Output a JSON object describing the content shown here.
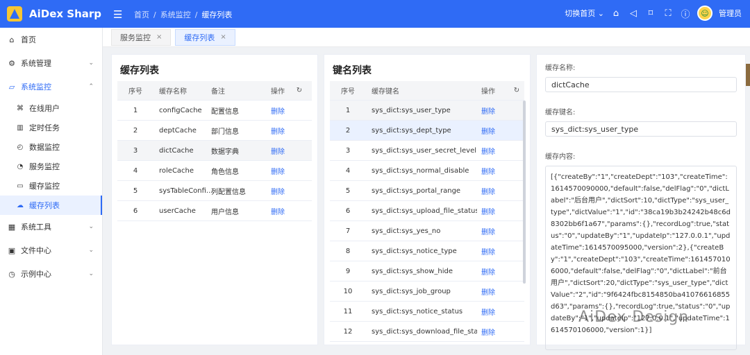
{
  "app": {
    "title": "AiDex Sharp",
    "menu_icon": "menu-fold-icon"
  },
  "breadcrumb": [
    "首页",
    "系统监控",
    "缓存列表"
  ],
  "topbar": {
    "switch_home": "切换首页",
    "user": "管理员"
  },
  "sidebar": {
    "items": [
      {
        "label": "首页",
        "icon": "home-icon"
      },
      {
        "label": "系统管理",
        "icon": "settings-icon"
      },
      {
        "label": "系统监控",
        "icon": "monitor-icon"
      },
      {
        "label": "系统工具",
        "icon": "grid-icon"
      },
      {
        "label": "文件中心",
        "icon": "file-icon"
      },
      {
        "label": "示例中心",
        "icon": "sample-icon"
      }
    ],
    "subitems": [
      {
        "label": "在线用户",
        "icon": "chart-icon"
      },
      {
        "label": "定时任务",
        "icon": "bar-icon"
      },
      {
        "label": "数据监控",
        "icon": "dashboard-icon"
      },
      {
        "label": "服务监控",
        "icon": "pie-icon"
      },
      {
        "label": "缓存监控",
        "icon": "cache-icon"
      },
      {
        "label": "缓存列表",
        "icon": "cloud-icon"
      }
    ]
  },
  "tabs": [
    {
      "label": "服务监控"
    },
    {
      "label": "缓存列表"
    }
  ],
  "cache_table": {
    "title": "缓存列表",
    "headers": [
      "序号",
      "缓存名称",
      "备注",
      "操作"
    ],
    "rows": [
      {
        "no": "1",
        "name": "configCache",
        "note": "配置信息",
        "action": "删除"
      },
      {
        "no": "2",
        "name": "deptCache",
        "note": "部门信息",
        "action": "删除"
      },
      {
        "no": "3",
        "name": "dictCache",
        "note": "数据字典",
        "action": "删除"
      },
      {
        "no": "4",
        "name": "roleCache",
        "note": "角色信息",
        "action": "删除"
      },
      {
        "no": "5",
        "name": "sysTableConfi...",
        "note": "列配置信息",
        "action": "删除"
      },
      {
        "no": "6",
        "name": "userCache",
        "note": "用户信息",
        "action": "删除"
      }
    ]
  },
  "key_table": {
    "title": "键名列表",
    "headers": [
      "序号",
      "缓存键名",
      "操作"
    ],
    "rows": [
      {
        "no": "1",
        "name": "sys_dict:sys_user_type",
        "action": "删除"
      },
      {
        "no": "2",
        "name": "sys_dict:sys_dept_type",
        "action": "删除"
      },
      {
        "no": "3",
        "name": "sys_dict:sys_user_secret_level",
        "action": "删除"
      },
      {
        "no": "4",
        "name": "sys_dict:sys_normal_disable",
        "action": "删除"
      },
      {
        "no": "5",
        "name": "sys_dict:sys_portal_range",
        "action": "删除"
      },
      {
        "no": "6",
        "name": "sys_dict:sys_upload_file_status",
        "action": "删除"
      },
      {
        "no": "7",
        "name": "sys_dict:sys_yes_no",
        "action": "删除"
      },
      {
        "no": "8",
        "name": "sys_dict:sys_notice_type",
        "action": "删除"
      },
      {
        "no": "9",
        "name": "sys_dict:sys_show_hide",
        "action": "删除"
      },
      {
        "no": "10",
        "name": "sys_dict:sys_job_group",
        "action": "删除"
      },
      {
        "no": "11",
        "name": "sys_dict:sys_notice_status",
        "action": "删除"
      },
      {
        "no": "12",
        "name": "sys_dict:sys_download_file_sta...",
        "action": "删除"
      }
    ]
  },
  "details": {
    "name_label": "缓存名称:",
    "name_value": "dictCache",
    "key_label": "缓存键名:",
    "key_value": "sys_dict:sys_user_type",
    "content_label": "缓存内容:",
    "content": "[{\"createBy\":\"1\",\"createDept\":\"103\",\"createTime\":1614570090000,\"default\":false,\"delFlag\":\"0\",\"dictLabel\":\"后台用户\",\"dictSort\":10,\"dictType\":\"sys_user_type\",\"dictValue\":\"1\",\"id\":\"38ca19b3b24242b48c6d8302bb6f1a67\",\"params\":{},\"recordLog\":true,\"status\":\"0\",\"updateBy\":\"1\",\"updateIp\":\"127.0.0.1\",\"updateTime\":1614570095000,\"version\":2},{\"createBy\":\"1\",\"createDept\":\"103\",\"createTime\":1614570106000,\"default\":false,\"delFlag\":\"0\",\"dictLabel\":\"前台用户\",\"dictSort\":20,\"dictType\":\"sys_user_type\",\"dictValue\":\"2\",\"id\":\"9f6424fbc8154850ba41076616855d63\",\"params\":{},\"recordLog\":true,\"status\":\"0\",\"updateBy\":\"1\",\"updateIp\":\"127.0.0.1\",\"updateTime\":1614570106000,\"version\":1}]"
  },
  "watermark": "AiDex Design",
  "colors": {
    "primary": "#2f6bf5",
    "topbar": "#2f6bf5",
    "selected": "#eaf1ff"
  }
}
